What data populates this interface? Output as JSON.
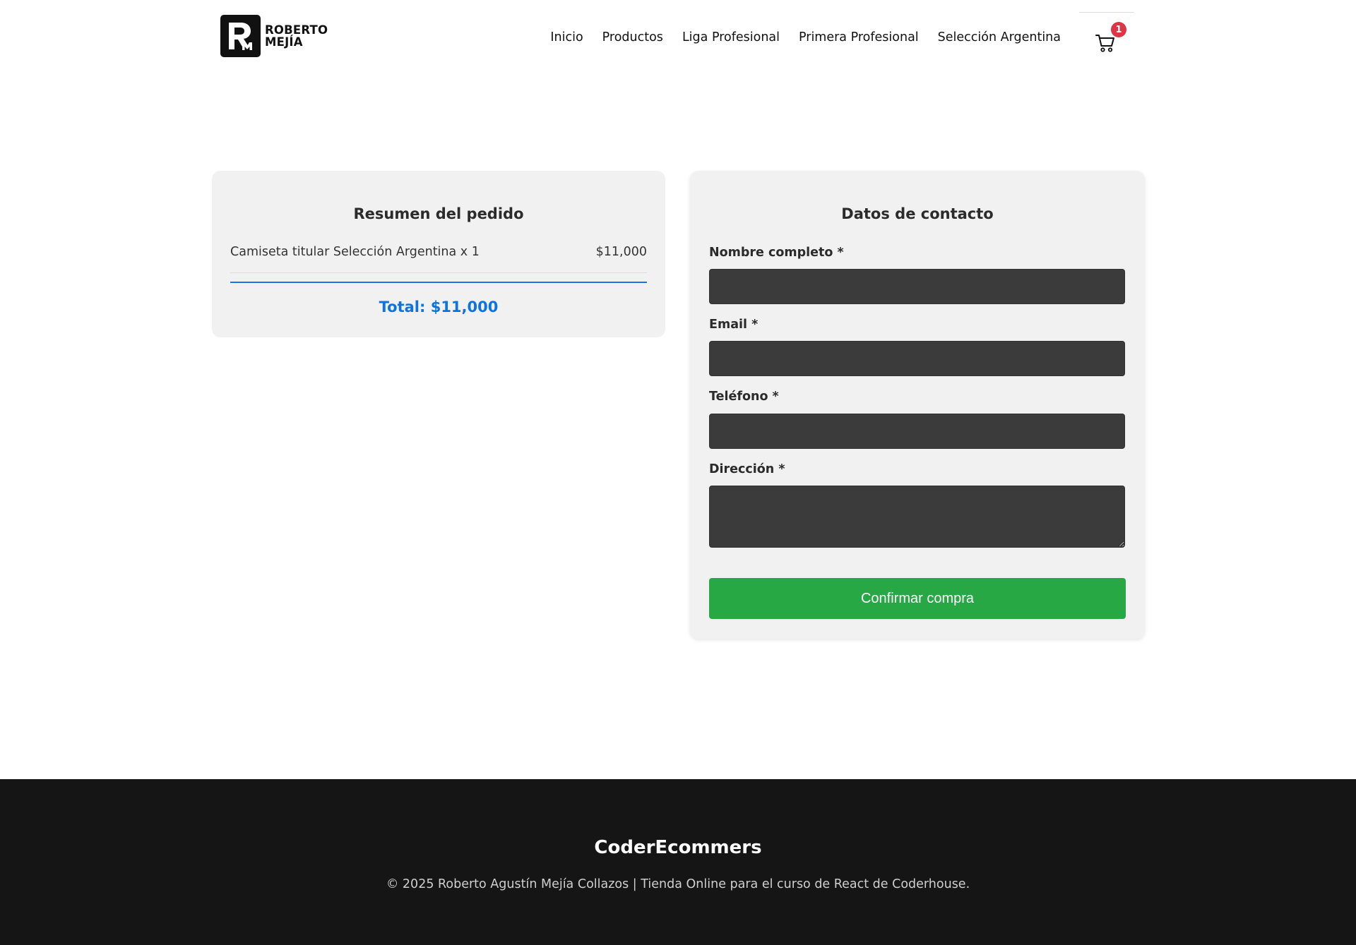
{
  "header": {
    "logo": {
      "line1": "ROBERTO",
      "line2": "MEJÍA"
    },
    "nav": [
      "Inicio",
      "Productos",
      "Liga Profesional",
      "Primera Profesional",
      "Selección Argentina"
    ],
    "cart_count": "1"
  },
  "summary": {
    "title": "Resumen del pedido",
    "items": [
      {
        "name": "Camiseta titular Selección Argentina x 1",
        "price": "$11,000"
      }
    ],
    "total": "Total: $11,000"
  },
  "contact": {
    "title": "Datos de contacto",
    "fields": {
      "name_label": "Nombre completo *",
      "email_label": "Email *",
      "phone_label": "Teléfono *",
      "address_label": "Dirección *"
    },
    "values": {
      "name": "",
      "email": "",
      "phone": "",
      "address": ""
    },
    "confirm_label": "Confirmar compra"
  },
  "footer": {
    "title": "CoderEcommers",
    "copyright": "© 2025 Roberto Agustín Mejía Collazos | Tienda Online para el curso de React de Coderhouse."
  },
  "colors": {
    "accent_blue": "#0d74de",
    "confirm_green": "#28a745",
    "badge_red": "#dc3545",
    "card_bg": "#f2f1f2",
    "footer_bg": "#151515"
  }
}
